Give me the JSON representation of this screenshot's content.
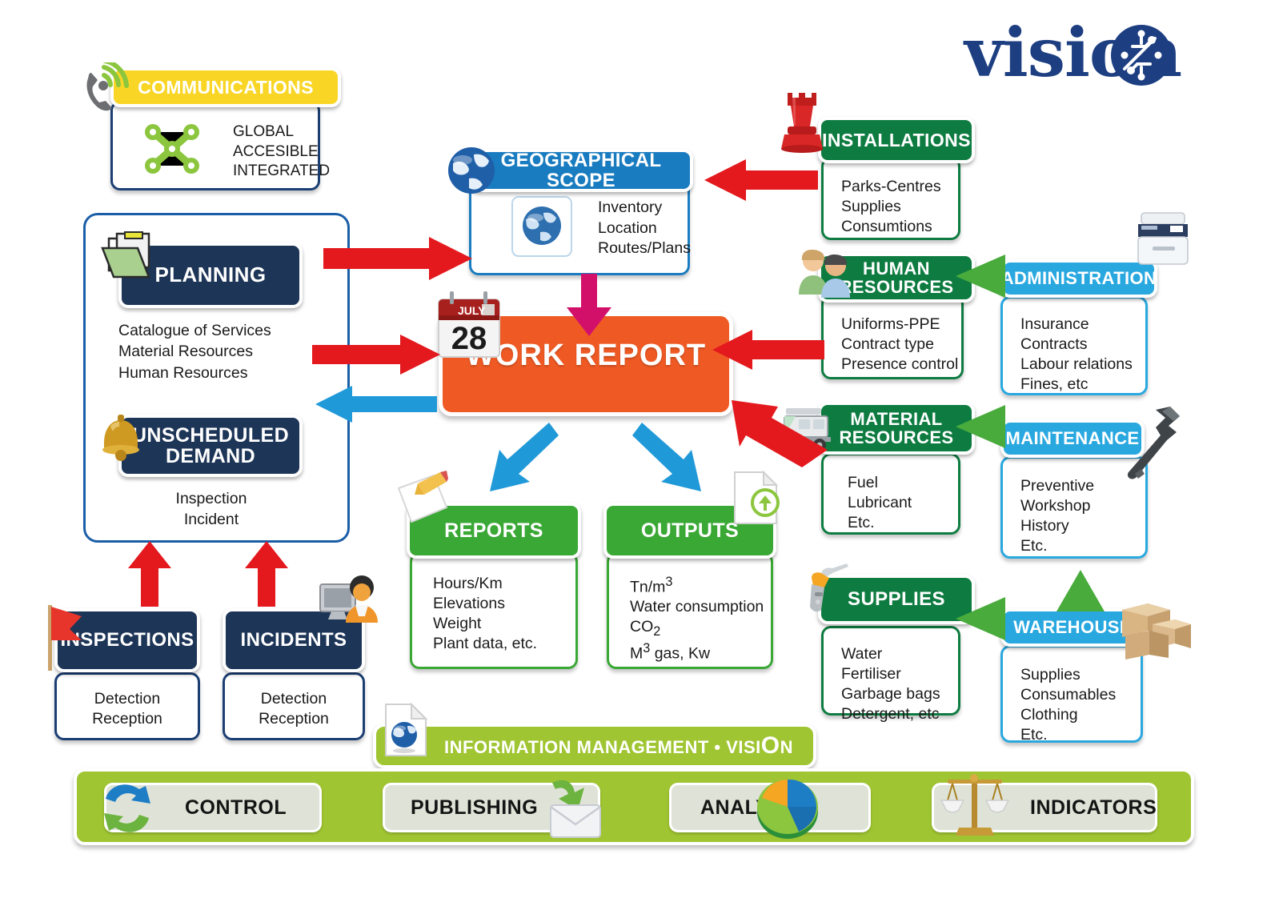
{
  "logo": {
    "text": "vision",
    "accent_color": "#1d3f82"
  },
  "communications": {
    "title": "COMMUNICATIONS",
    "icon": "phone-signal-icon",
    "body_icon": "network-nodes-icon",
    "lines": [
      "GLOBAL",
      "ACCESIBLE",
      "INTEGRATED"
    ]
  },
  "planning": {
    "title": "PLANNING",
    "icon": "folder-icon",
    "lines": [
      "Catalogue of Services",
      "Material Resources",
      "Human Resources"
    ]
  },
  "unscheduled_demand": {
    "title": "UNSCHEDULED DEMAND",
    "title_line1": "UNSCHEDULED",
    "title_line2": "DEMAND",
    "icon": "bell-icon",
    "lines": [
      "Inspection",
      "Incident"
    ]
  },
  "inspections": {
    "title": "INSPECTIONS",
    "icon": "red-flag-icon",
    "lines": [
      "Detection",
      "Reception"
    ]
  },
  "incidents": {
    "title": "INCIDENTS",
    "icon": "user-computer-icon",
    "lines": [
      "Detection",
      "Reception"
    ]
  },
  "geographical_scope": {
    "title": "GEOGRAPHICAL SCOPE",
    "icon": "globe-icon",
    "body_icon": "globe-icon",
    "lines": [
      "Inventory",
      "Location",
      "Routes/Plans"
    ]
  },
  "work_report": {
    "title": "WORK REPORT",
    "icon": "calendar-icon",
    "calendar_month": "JULY",
    "calendar_day": "28"
  },
  "reports": {
    "title": "REPORTS",
    "icon": "note-pencil-icon",
    "lines": [
      "Hours/Km",
      "Elevations",
      "Weight",
      "Plant data, etc."
    ]
  },
  "outputs": {
    "title": "OUTPUTS",
    "icon": "document-upload-icon",
    "lines_html": [
      "Tn/m<sup>3</sup>",
      "Water consumption",
      "CO<sub>2</sub>",
      "M<sup>3</sup> gas, Kw"
    ]
  },
  "installations": {
    "title": "INSTALLATIONS",
    "icon": "chess-rook-icon",
    "lines": [
      "Parks-Centres",
      "Supplies",
      "Consumtions"
    ]
  },
  "human_resources": {
    "title": "HUMAN RESOURCES",
    "title_line1": "HUMAN",
    "title_line2": "RESOURCES",
    "icon": "two-people-icon",
    "lines": [
      "Uniforms-PPE",
      "Contract type",
      "Presence control"
    ]
  },
  "material_resources": {
    "title": "MATERIAL RESOURCES",
    "title_line1": "MATERIAL",
    "title_line2": "RESOURCES",
    "icon": "street-sweeper-truck-icon",
    "lines": [
      "Fuel",
      "Lubricant",
      "Etc."
    ]
  },
  "supplies": {
    "title": "SUPPLIES",
    "icon": "fuel-nozzle-icon",
    "lines": [
      "Water",
      "Fertiliser",
      "Garbage bags",
      "Detergent, etc"
    ]
  },
  "administration": {
    "title": "ADMINISTRATION",
    "icon": "printer-icon",
    "lines": [
      "Insurance",
      "Contracts",
      "Labour relations",
      "Fines, etc"
    ]
  },
  "maintenance": {
    "title": "MAINTENANCE",
    "icon": "wrench-icon",
    "lines": [
      "Preventive",
      "Workshop",
      "History",
      "Etc."
    ]
  },
  "warehouse": {
    "title": "WAREHOUSE",
    "icon": "boxes-icon",
    "lines": [
      "Supplies",
      "Consumables",
      "Clothing",
      "Etc."
    ]
  },
  "information_management": {
    "title_prefix": "INFORMATION MANAGEMENT • VISI",
    "title_accent": "O",
    "title_suffix": "N",
    "icon": "globe-document-icon"
  },
  "bottom_bar": {
    "tiles": [
      {
        "label": "CONTROL",
        "icon": "refresh-cycle-icon"
      },
      {
        "label": "PUBLISHING",
        "icon": "envelope-download-icon"
      },
      {
        "label": "ANALYSIS",
        "icon": "pie-chart-icon"
      },
      {
        "label": "INDICATORS",
        "icon": "scales-balance-icon"
      }
    ]
  },
  "colors": {
    "navy": "#1d3557",
    "panel_blue": "#1b5ea8",
    "dark_green": "#0e7c41",
    "light_green": "#3aa835",
    "header_blue": "#1a7cc0",
    "cyan": "#29a8e0",
    "yellow": "#f9d626",
    "olive": "#a0c532",
    "orange": "#ef5a24",
    "red_arrow": "#e3191e",
    "magenta_arrow": "#d2106a",
    "blue_arrow": "#2099d8",
    "green_arrow": "#49ab3c"
  }
}
